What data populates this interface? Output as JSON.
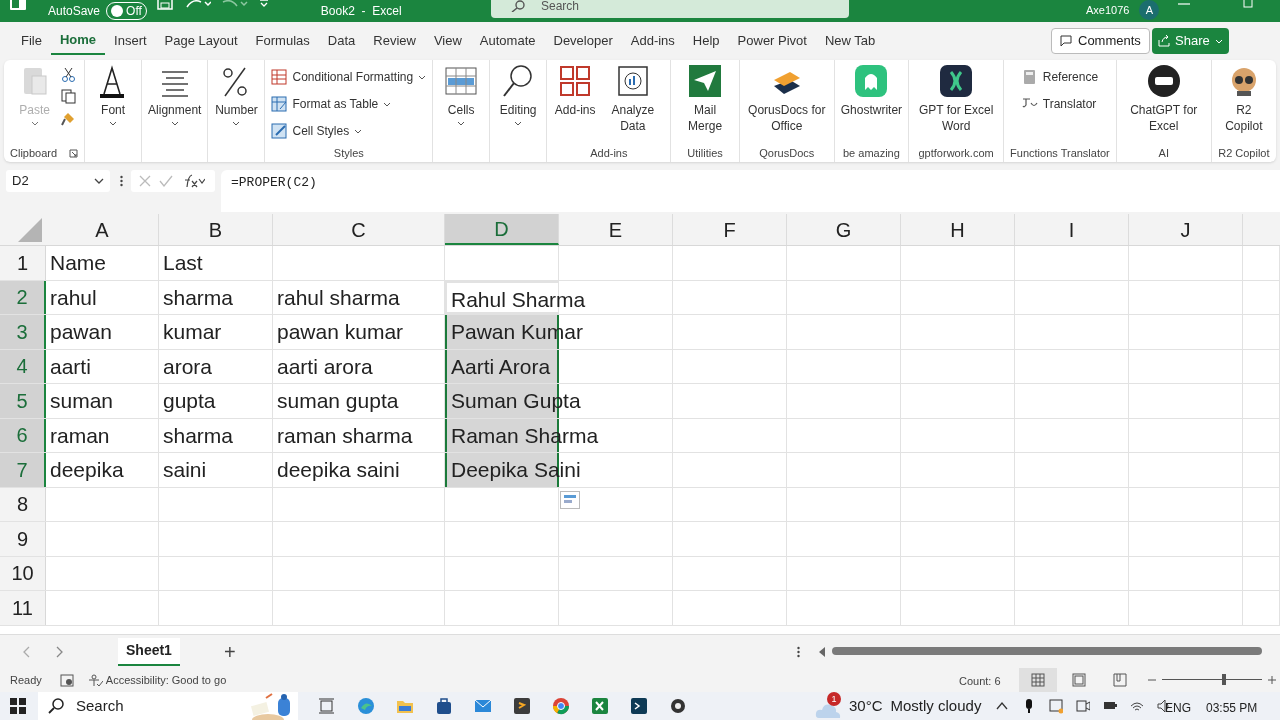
{
  "title_bar": {
    "autosave_label": "AutoSave",
    "autosave_toggle": "Off",
    "autosave_on": false,
    "title": "Book2  -  Excel",
    "search": "Search",
    "user": "Axe1076",
    "avatar": "A"
  },
  "menu_tabs": [
    {
      "label": "File",
      "selected": false
    },
    {
      "label": "Home",
      "selected": true
    },
    {
      "label": "Insert",
      "selected": false
    },
    {
      "label": "Page Layout",
      "selected": false
    },
    {
      "label": "Formulas",
      "selected": false
    },
    {
      "label": "Data",
      "selected": false
    },
    {
      "label": "Review",
      "selected": false
    },
    {
      "label": "View",
      "selected": false
    },
    {
      "label": "Automate",
      "selected": false
    },
    {
      "label": "Developer",
      "selected": false
    },
    {
      "label": "Add-ins",
      "selected": false
    },
    {
      "label": "Help",
      "selected": false
    },
    {
      "label": "Power Pivot",
      "selected": false
    },
    {
      "label": "New Tab",
      "selected": false
    }
  ],
  "comments_button": "Comments",
  "share_button": "Share",
  "ribbon": [
    {
      "label": "Clipboard",
      "launcher": true,
      "buttons": [
        {
          "kind": "large",
          "label": "Paste",
          "disabled": true
        },
        {
          "kind": "tiny"
        },
        {
          "kind": "tiny"
        },
        {
          "kind": "tiny"
        }
      ]
    },
    {
      "buttons": [
        {
          "kind": "large",
          "label": "Font"
        }
      ]
    },
    {
      "buttons": [
        {
          "kind": "large",
          "label": "Alignment"
        }
      ]
    },
    {
      "buttons": [
        {
          "kind": "large",
          "label": "Number"
        }
      ]
    },
    {
      "label": "Styles",
      "buttons": [
        {
          "kind": "small",
          "label": "Conditional Formatting"
        },
        {
          "kind": "small",
          "label": "Format as Table"
        },
        {
          "kind": "small",
          "label": "Cell Styles"
        }
      ]
    },
    {
      "buttons": [
        {
          "kind": "large",
          "label": "Cells"
        }
      ]
    },
    {
      "buttons": [
        {
          "kind": "large",
          "label": "Editing"
        }
      ]
    },
    {
      "label": "Add-ins",
      "buttons": [
        {
          "kind": "large",
          "label": "Add-ins"
        },
        {
          "kind": "large",
          "label": "Analyze Data"
        }
      ]
    },
    {
      "label": "Utilities",
      "buttons": [
        {
          "kind": "large",
          "label": "Mail Merge"
        }
      ]
    },
    {
      "label": "QorusDocs",
      "buttons": [
        {
          "kind": "large",
          "label": "QorusDocs for Office"
        }
      ]
    },
    {
      "label": "be amazing",
      "buttons": [
        {
          "kind": "large",
          "label": "Ghostwriter"
        }
      ]
    },
    {
      "label": "gptforwork.com",
      "buttons": [
        {
          "kind": "large",
          "label": "GPT for Excel Word"
        }
      ]
    },
    {
      "label": "Functions Translator",
      "buttons": [
        {
          "kind": "small",
          "label": "Reference"
        },
        {
          "kind": "small",
          "label": "Translator"
        }
      ]
    },
    {
      "label": "AI",
      "buttons": [
        {
          "kind": "large",
          "label": "ChatGPT for Excel"
        }
      ]
    },
    {
      "label": "R2 Copilot",
      "buttons": [
        {
          "kind": "large",
          "label": "R2 Copilot"
        }
      ]
    }
  ],
  "formula_bar": {
    "name_box": "D2",
    "formula": "=PROPER(C2)"
  },
  "columns": [
    {
      "label": "A",
      "selected": false
    },
    {
      "label": "B",
      "selected": false
    },
    {
      "label": "C",
      "selected": false
    },
    {
      "label": "D",
      "selected": true
    },
    {
      "label": "E",
      "selected": false
    },
    {
      "label": "F",
      "selected": false
    },
    {
      "label": "G",
      "selected": false
    },
    {
      "label": "H",
      "selected": false
    },
    {
      "label": "I",
      "selected": false
    },
    {
      "label": "J",
      "selected": false
    }
  ],
  "rows": [
    {
      "number": "1",
      "selected": false,
      "active": false,
      "cells": [
        "Name",
        "Last"
      ]
    },
    {
      "number": "2",
      "selected": true,
      "active": true,
      "cells": [
        "rahul",
        "sharma",
        "rahul sharma",
        "Rahul Sharma"
      ]
    },
    {
      "number": "3",
      "selected": true,
      "active": false,
      "cells": [
        "pawan",
        "kumar",
        "pawan kumar",
        "Pawan Kumar"
      ]
    },
    {
      "number": "4",
      "selected": true,
      "active": false,
      "cells": [
        "aarti",
        "arora",
        "aarti arora",
        "Aarti Arora"
      ]
    },
    {
      "number": "5",
      "selected": true,
      "active": false,
      "cells": [
        "suman",
        "gupta",
        "suman gupta",
        "Suman Gupta"
      ]
    },
    {
      "number": "6",
      "selected": true,
      "active": false,
      "cells": [
        "raman",
        "sharma",
        "raman sharma",
        "Raman Sharma"
      ]
    },
    {
      "number": "7",
      "selected": true,
      "active": false,
      "cells": [
        "deepika",
        "saini",
        "deepika saini",
        "Deepika Saini"
      ]
    },
    {
      "number": "8",
      "selected": false,
      "active": false
    },
    {
      "number": "9",
      "selected": false,
      "active": false
    },
    {
      "number": "10",
      "selected": false,
      "active": false
    },
    {
      "number": "11",
      "selected": false,
      "active": false
    }
  ],
  "sheet_tabs": [
    {
      "label": "Sheet1",
      "selected": true
    }
  ],
  "add_sheet": "+",
  "status_bar": {
    "ready": "Ready",
    "accessibility": "Accessibility: Good to go",
    "count": "Count: 6",
    "views": [
      {
        "selected": true
      },
      {
        "selected": false
      },
      {
        "selected": false
      }
    ],
    "zoom": {
      "level": 0.62
    }
  },
  "taskbar": {
    "search": "Search",
    "weather_badge": "1",
    "temperature": "30°C",
    "weather": "Mostly cloudy",
    "language": "ENG",
    "time": "03:55 PM"
  }
}
